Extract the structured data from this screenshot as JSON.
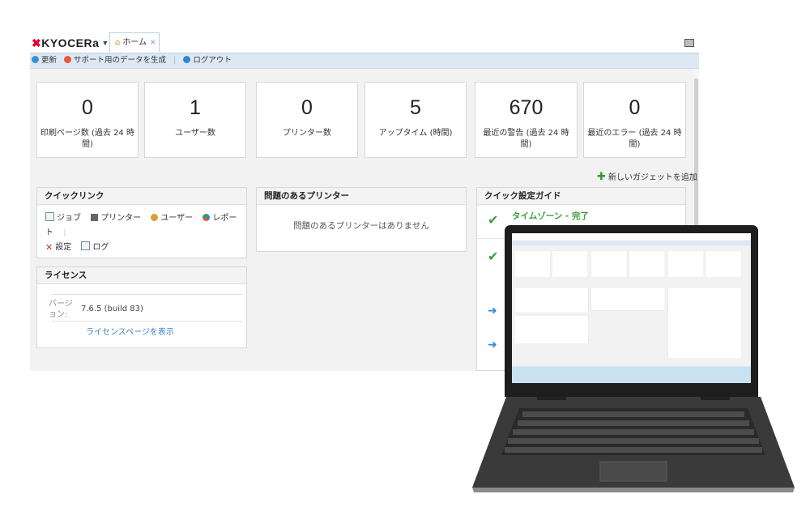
{
  "app": {
    "brand": "KYOCERa",
    "tab_label": "ホーム",
    "toolbar": {
      "refresh": "更新",
      "support_data": "サポート用のデータを生成",
      "logout": "ログアウト"
    }
  },
  "stats": [
    {
      "value": "0",
      "label": "印刷ページ数 (過去 24 時間)"
    },
    {
      "value": "1",
      "label": "ユーザー数"
    },
    {
      "value": "0",
      "label": "プリンター数"
    },
    {
      "value": "5",
      "label": "アップタイム (時間)"
    },
    {
      "value": "670",
      "label": "最近の警告 (過去 24 時間)"
    },
    {
      "value": "0",
      "label": "最近のエラー (過去 24 時間)"
    }
  ],
  "add_gadget": "新しいガジェットを追加",
  "quick_links": {
    "title": "クイックリンク",
    "items": [
      "ジョブ",
      "プリンター",
      "ユーザー",
      "レポート",
      "設定",
      "ログ"
    ]
  },
  "problem_printers": {
    "title": "問題のあるプリンター",
    "empty_text": "問題のあるプリンターはありません"
  },
  "license": {
    "title": "ライセンス",
    "version_label": "バージョン:",
    "version_value": "7.6.5 (build 83)",
    "link": "ライセンスページを表示"
  },
  "quick_setup": {
    "title": "クイック設定ガイド",
    "items": [
      {
        "title": "タイムゾーン - 完了"
      }
    ]
  },
  "colors": {
    "accent_blue": "#3a7fc6",
    "check_green": "#3c9f3c",
    "brand_red": "#e8002a",
    "toolbar_bg": "#dde8f3"
  }
}
